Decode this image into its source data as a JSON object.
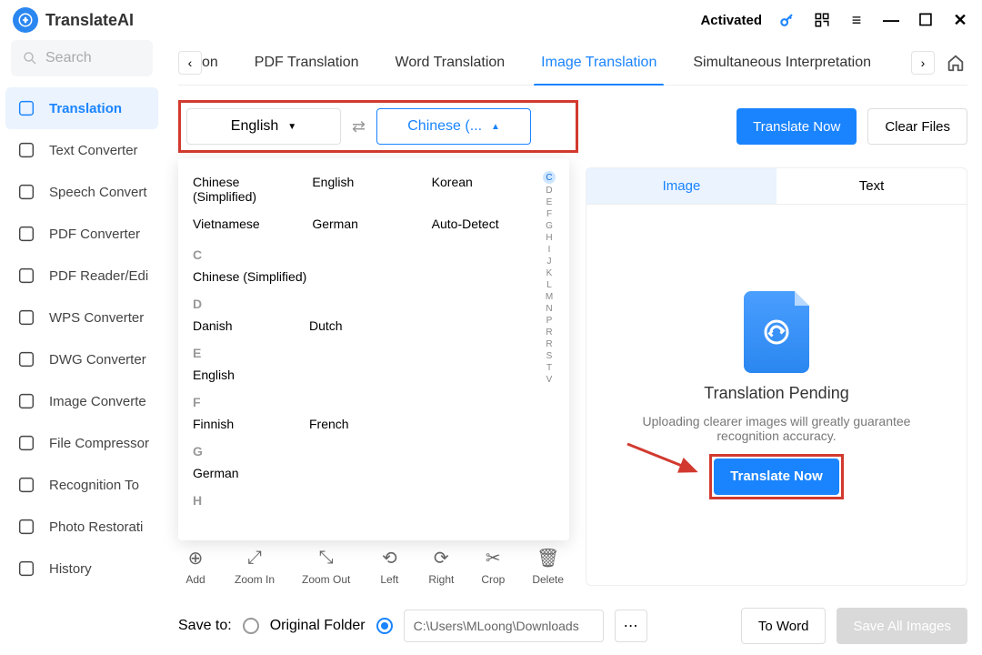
{
  "titlebar": {
    "app_name": "TranslateAI",
    "activated": "Activated"
  },
  "sidebar": {
    "search_placeholder": "Search",
    "items": [
      {
        "label": "Translation",
        "active": true
      },
      {
        "label": "Text Converter"
      },
      {
        "label": "Speech Convert"
      },
      {
        "label": "PDF Converter"
      },
      {
        "label": "PDF Reader/Edi"
      },
      {
        "label": "WPS Converter"
      },
      {
        "label": "DWG Converter"
      },
      {
        "label": "Image Converte"
      },
      {
        "label": "File Compressor"
      },
      {
        "label": "Recognition To"
      },
      {
        "label": "Photo Restorati"
      },
      {
        "label": "History"
      }
    ]
  },
  "tabs": [
    "tion",
    "PDF Translation",
    "Word Translation",
    "Image Translation",
    "Simultaneous Interpretation"
  ],
  "active_tab": 3,
  "lang": {
    "source": "English",
    "target": "Chinese (..."
  },
  "actions": {
    "translate": "Translate Now",
    "clear": "Clear Files"
  },
  "dropdown": {
    "favorites": [
      [
        "Chinese (Simplified)",
        "English",
        "Korean"
      ],
      [
        "Vietnamese",
        "German",
        "Auto-Detect"
      ]
    ],
    "groups": [
      {
        "letter": "C",
        "langs": [
          "Chinese (Simplified)"
        ]
      },
      {
        "letter": "D",
        "langs": [
          "Danish",
          "Dutch"
        ]
      },
      {
        "letter": "E",
        "langs": [
          "English"
        ]
      },
      {
        "letter": "F",
        "langs": [
          "Finnish",
          "French"
        ]
      },
      {
        "letter": "G",
        "langs": [
          "German"
        ]
      },
      {
        "letter": "H",
        "langs": []
      }
    ],
    "index": [
      "C",
      "D",
      "E",
      "F",
      "G",
      "H",
      "I",
      "J",
      "K",
      "L",
      "M",
      "N",
      "P",
      "R",
      "R",
      "S",
      "T",
      "V"
    ]
  },
  "tools": [
    "Add",
    "Zoom In",
    "Zoom Out",
    "Left",
    "Right",
    "Crop",
    "Delete"
  ],
  "preview": {
    "subtabs": [
      "Image",
      "Text"
    ],
    "title": "Translation Pending",
    "hint": "Uploading clearer images will greatly guarantee recognition accuracy.",
    "cta": "Translate Now"
  },
  "save": {
    "label": "Save to:",
    "opt1": "Original Folder",
    "path": "C:\\Users\\MLoong\\Downloads",
    "to_word": "To Word",
    "save_all": "Save All Images"
  }
}
